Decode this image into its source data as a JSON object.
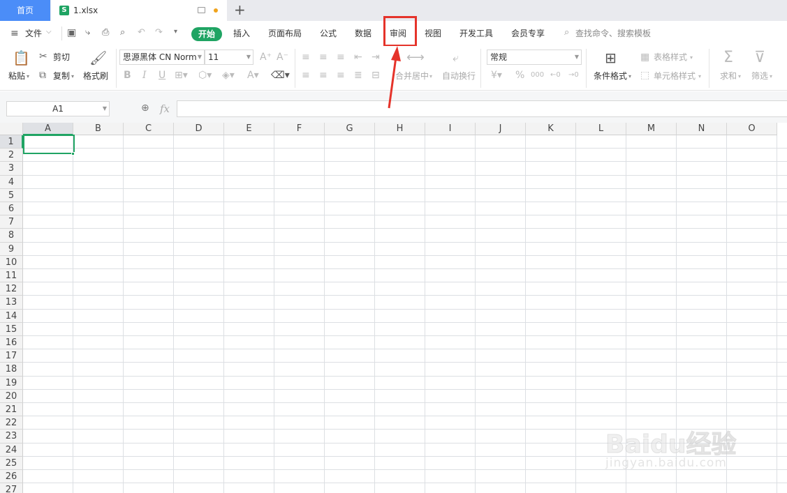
{
  "tabs": {
    "home": "首页",
    "file_icon": "S",
    "file_name": "1.xlsx",
    "new_tab": "+"
  },
  "menu": {
    "hamburger_icon": "hamburger-icon",
    "file": "文件",
    "start": "开始",
    "items": [
      "插入",
      "页面布局",
      "公式",
      "数据",
      "审阅",
      "视图",
      "开发工具",
      "会员专享"
    ],
    "search_placeholder": "查找命令、搜索模板"
  },
  "ribbon": {
    "paste": "粘贴",
    "cut": "剪切",
    "copy": "复制",
    "format_painter": "格式刷",
    "font_name": "思源黑体 CN Norm",
    "font_size": "11",
    "merge_center": "合并居中",
    "wrap_text": "自动换行",
    "number_format": "常规",
    "conditional_format": "条件格式",
    "table_style": "表格样式",
    "cell_style": "单元格样式",
    "sum": "求和",
    "filter": "筛选",
    "bold": "B",
    "italic": "I",
    "underline": "U",
    "font_color_letter": "A",
    "currency": "¥",
    "percent": "%",
    "thousands": "000"
  },
  "formula_bar": {
    "name_box": "A1",
    "fx": "fx",
    "value": ""
  },
  "grid": {
    "columns": [
      "A",
      "B",
      "C",
      "D",
      "E",
      "F",
      "G",
      "H",
      "I",
      "J",
      "K",
      "L",
      "M",
      "N",
      "O"
    ],
    "rows": [
      "1",
      "2",
      "3",
      "4",
      "5",
      "6",
      "7",
      "8",
      "9",
      "10",
      "11",
      "12",
      "13",
      "14",
      "15",
      "16",
      "17",
      "18",
      "19",
      "20",
      "21",
      "22",
      "23",
      "24",
      "25",
      "26",
      "27"
    ],
    "selected_cell": "A1"
  },
  "watermark": {
    "main": "Baidu经验",
    "sub": "jingyan.baidu.com"
  },
  "colors": {
    "accent_green": "#1fa463",
    "tab_blue": "#4b8df8",
    "highlight_red": "#e5332a"
  }
}
